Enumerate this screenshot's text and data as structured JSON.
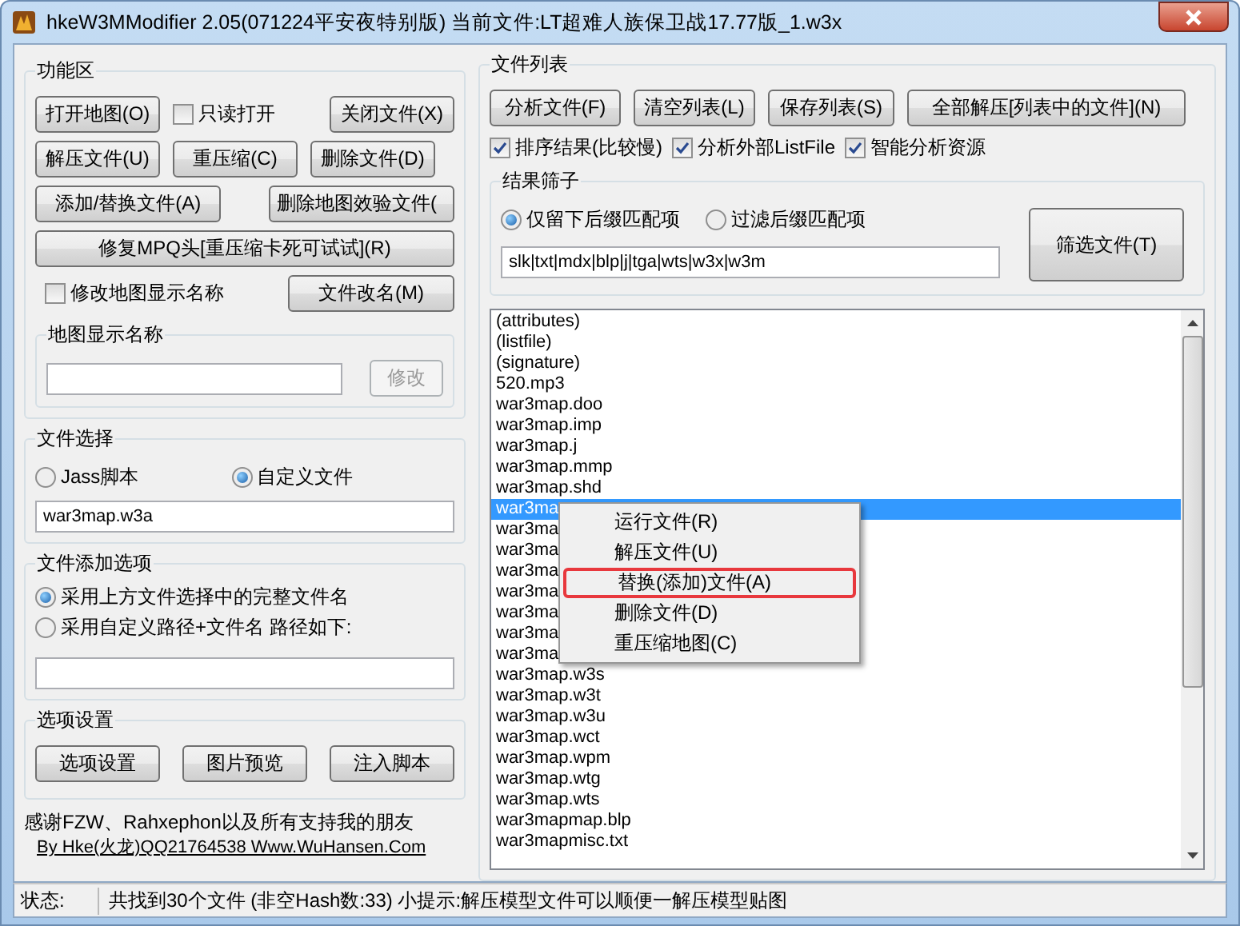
{
  "window": {
    "title": "hkeW3MModifier 2.05(071224平安夜特别版) 当前文件:LT超难人族保卫战17.77版_1.w3x"
  },
  "function_area": {
    "title": "功能区",
    "row1": {
      "open": "打开地图(O)",
      "readonly": {
        "label": "只读打开",
        "checked": false
      },
      "close": "关闭文件(X)"
    },
    "row2": [
      "解压文件(U)",
      "重压缩(C)",
      "删除文件(D)"
    ],
    "row3": [
      "添加/替换文件(A)",
      "删除地图效验文件("
    ],
    "repair": "修复MPQ头[重压缩卡死可试试](R)",
    "rename_check": {
      "label": "修改地图显示名称",
      "checked": false
    },
    "rename_button": "文件改名(M)",
    "display_name": {
      "title": "地图显示名称",
      "button": {
        "label": "修改",
        "disabled": true
      }
    }
  },
  "file_select": {
    "title": "文件选择",
    "options": [
      {
        "label": "Jass脚本",
        "selected": false
      },
      {
        "label": "自定义文件",
        "selected": true
      }
    ],
    "value": "war3map.w3a"
  },
  "add_options": {
    "title": "文件添加选项",
    "options": [
      {
        "label": "采用上方文件选择中的完整文件名",
        "selected": true
      },
      {
        "label": "采用自定义路径+文件名 路径如下:",
        "selected": false
      }
    ]
  },
  "settings": {
    "title": "选项设置",
    "buttons": [
      "选项设置",
      "图片预览",
      "注入脚本"
    ]
  },
  "thanks": "感谢FZW、Rahxephon以及所有支持我的朋友",
  "link": "By Hke(火龙)QQ21764538 Www.WuHansen.Com",
  "file_list": {
    "title": "文件列表",
    "buttons": [
      "分析文件(F)",
      "清空列表(L)",
      "保存列表(S)",
      "全部解压[列表中的文件](N)"
    ],
    "checks": [
      {
        "label": "排序结果(比较慢)",
        "checked": true
      },
      {
        "label": "分析外部ListFile",
        "checked": true
      },
      {
        "label": "智能分析资源",
        "checked": true
      }
    ],
    "filter": {
      "title": "结果筛子",
      "options": [
        {
          "label": "仅留下后缀匹配项",
          "selected": true
        },
        {
          "label": "过滤后缀匹配项",
          "selected": false
        }
      ],
      "value": "slk|txt|mdx|blp|j|tga|wts|w3x|w3m",
      "button": "筛选文件(T)"
    },
    "items": [
      {
        "name": "(attributes)",
        "selected": false
      },
      {
        "name": "(listfile)",
        "selected": false
      },
      {
        "name": "(signature)",
        "selected": false
      },
      {
        "name": "520.mp3",
        "selected": false
      },
      {
        "name": "war3map.doo",
        "selected": false
      },
      {
        "name": "war3map.imp",
        "selected": false
      },
      {
        "name": "war3map.j",
        "selected": false
      },
      {
        "name": "war3map.mmp",
        "selected": false
      },
      {
        "name": "war3map.shd",
        "selected": false
      },
      {
        "name": "war3ma",
        "selected": true
      },
      {
        "name": "war3ma",
        "selected": false
      },
      {
        "name": "war3ma",
        "selected": false
      },
      {
        "name": "war3ma",
        "selected": false
      },
      {
        "name": "war3ma",
        "selected": false
      },
      {
        "name": "war3ma",
        "selected": false
      },
      {
        "name": "war3ma",
        "selected": false
      },
      {
        "name": "war3ma",
        "selected": false
      },
      {
        "name": "war3map.w3s",
        "selected": false
      },
      {
        "name": "war3map.w3t",
        "selected": false
      },
      {
        "name": "war3map.w3u",
        "selected": false
      },
      {
        "name": "war3map.wct",
        "selected": false
      },
      {
        "name": "war3map.wpm",
        "selected": false
      },
      {
        "name": "war3map.wtg",
        "selected": false
      },
      {
        "name": "war3map.wts",
        "selected": false
      },
      {
        "name": "war3mapmap.blp",
        "selected": false
      },
      {
        "name": "war3mapmisc.txt",
        "selected": false
      }
    ]
  },
  "context_menu": [
    {
      "label": "运行文件(R)",
      "marked": false
    },
    {
      "label": "解压文件(U)",
      "marked": false
    },
    {
      "label": "替换(添加)文件(A)",
      "marked": true
    },
    {
      "label": "删除文件(D)",
      "marked": false
    },
    {
      "label": "重压缩地图(C)",
      "marked": false
    }
  ],
  "status_bar": {
    "label": "状态:",
    "text": "共找到30个文件 (非空Hash数:33) 小提示:解压模型文件可以顺便一解压模型贴图"
  }
}
